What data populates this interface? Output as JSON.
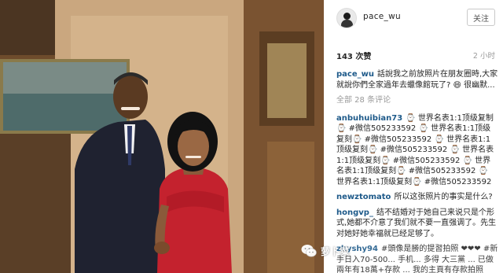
{
  "post": {
    "username": "pace_wu",
    "follow_label": "关注",
    "likes": "143 次赞",
    "time_ago": "2 小时"
  },
  "caption": {
    "user": "pace_wu",
    "text": "話說我之前放照片在朋友圈時,大家就說你們全家過年去蠟像館玩了? 😄 很幽默..."
  },
  "view_all_comments": "全部 28 条评论",
  "comments": [
    {
      "user": "anbuhuibian73",
      "text": "⌚ 世界名表1:1顶级复制⌚ #微信505233592 ⌚ 世界名表1:1顶级复刻⌚ #微信505233592 ⌚ 世界名表1:1顶级复刻⌚ #微信505233592 ⌚ 世界名表1:1顶级复刻⌚ #微信505233592 ⌚ 世界名表1:1顶级复刻⌚ #微信505233592 ⌚ 世界名表1:1顶级复刻⌚ #微信505233592"
    },
    {
      "user": "newztomato",
      "text": "所以这张照片的事实是什么?"
    },
    {
      "user": "hongvp_",
      "text": "结不结婚对于她自己来说只是个形式,她都不介意了我们就不要一直强调了。先生对她好她幸福就已经足够了。"
    },
    {
      "user": "zhyshy94",
      "text": "#頭像是勝的提習拍照 ❤❤❤ #新手日入70-500... 手机... 多得 大三黨 ... 已做兩年有18萬+存款 ... 我的主頁有存款拍照"
    }
  ],
  "watermark": {
    "text": "萝卜菜"
  },
  "colors": {
    "username_link": "#1e5a8a",
    "muted": "#999999",
    "photo_wall": "#6b4a2a",
    "dress_red": "#c4222e"
  },
  "icons": {
    "avatar": "user-avatar-icon",
    "watermark": "wechat-icon"
  }
}
